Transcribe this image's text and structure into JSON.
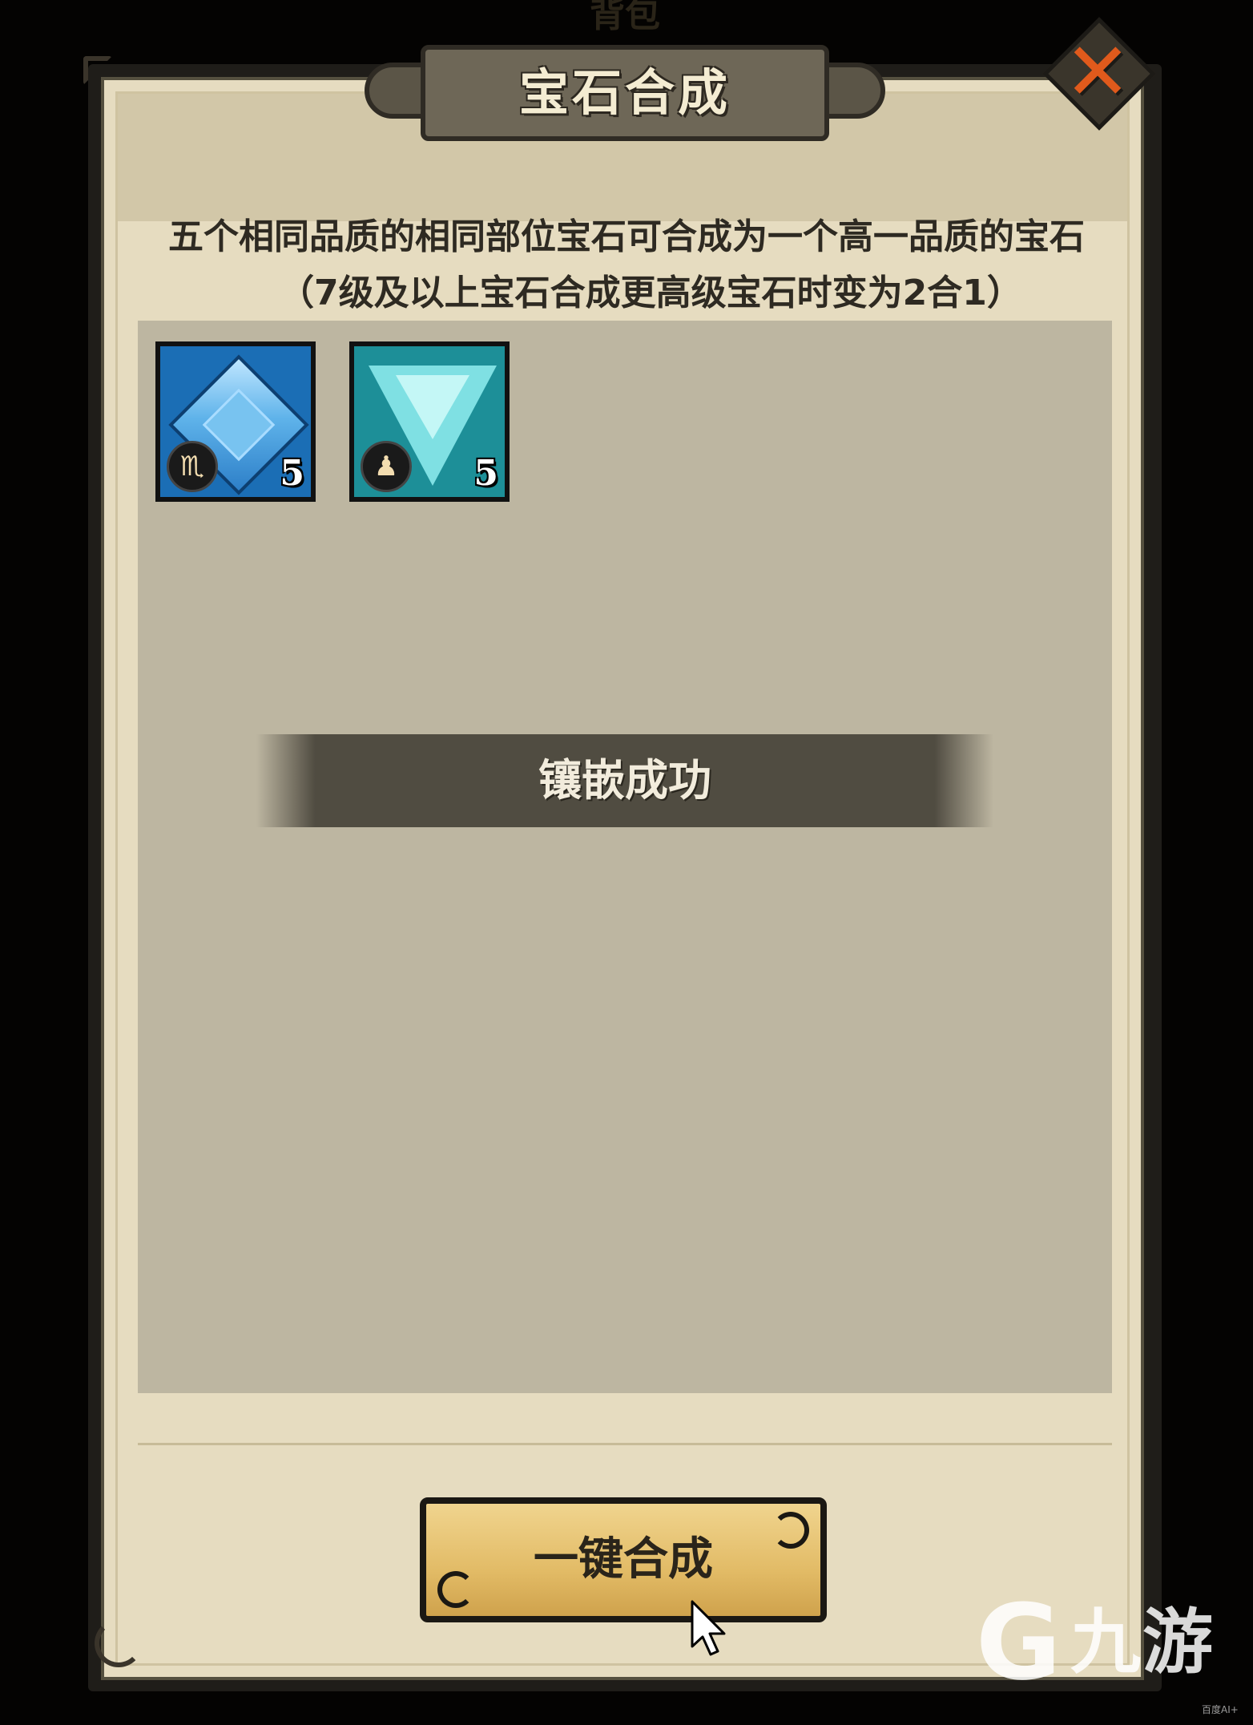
{
  "top_background_text": "背包",
  "dialog": {
    "title": "宝石合成",
    "close_symbol": "✕",
    "description_line1": "五个相同品质的相同部位宝石可合成为一个高一品质的宝石",
    "description_line2": "（7级及以上宝石合成更高级宝石时变为2合1）"
  },
  "gems": [
    {
      "icon": "blue-diamond-gem-icon",
      "badge_icon": "scorpio-icon",
      "badge_glyph": "♏",
      "count": "5",
      "color": "#1b6eb5"
    },
    {
      "icon": "teal-triangle-gem-icon",
      "badge_icon": "figure-icon",
      "badge_glyph": "♟",
      "count": "5",
      "color": "#1d8f98"
    }
  ],
  "toast": {
    "text": "镶嵌成功"
  },
  "merge_button": {
    "label": "一键合成"
  },
  "watermark": {
    "logo_glyph": "G",
    "text": "九游",
    "small_text": "百度AI+"
  },
  "colors": {
    "panel": "#e6dcc0",
    "content": "#bdb6a1",
    "button": "#e2bb66",
    "close": "#e05a1c"
  }
}
